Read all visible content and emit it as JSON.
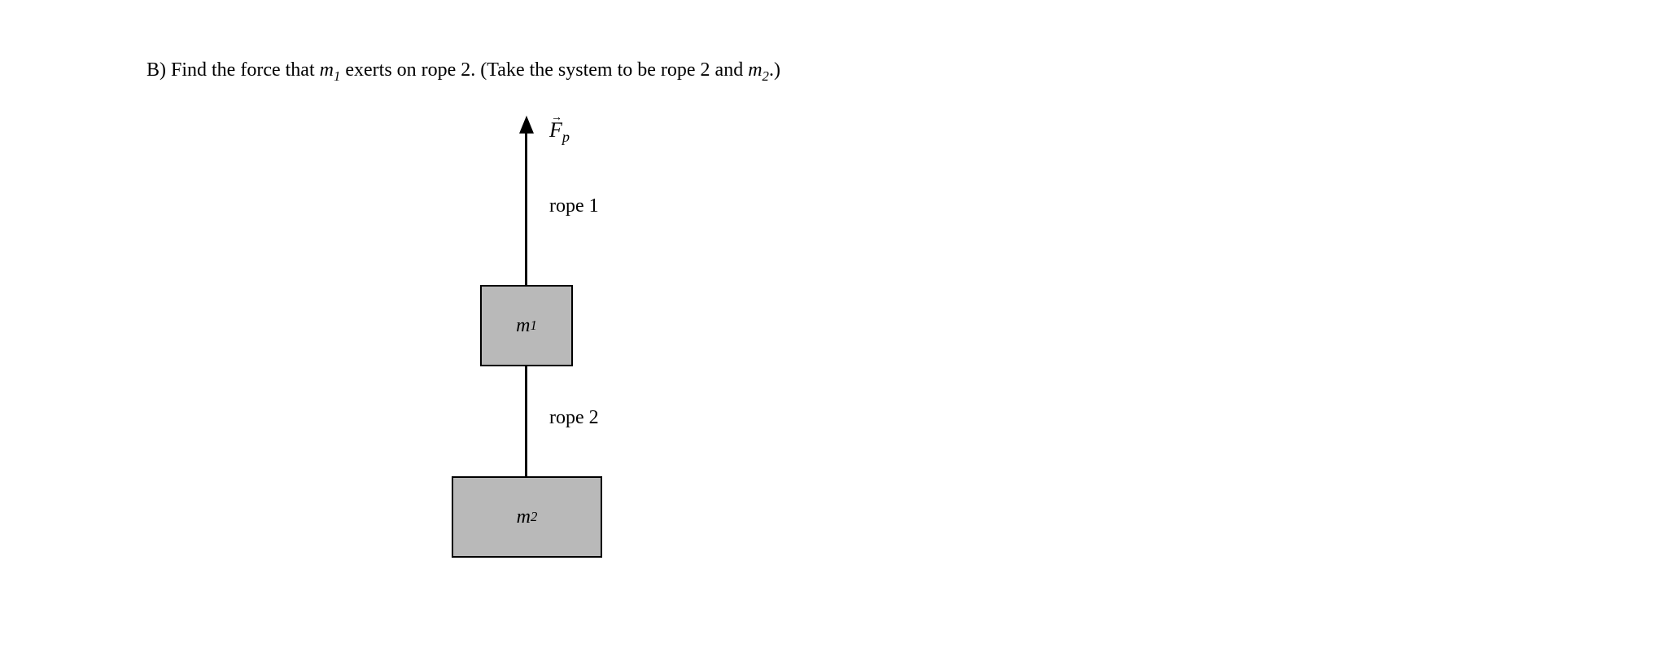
{
  "question": {
    "label": "B)",
    "prefix": "Find the force that ",
    "m1": "m",
    "m1_sub": "1",
    "middle": " exerts on rope 2. (Take the system to be rope 2 and ",
    "m2": "m",
    "m2_sub": "2",
    "suffix": ".)"
  },
  "diagram": {
    "force_label_F": "F",
    "force_label_sub": "p",
    "rope1_label": "rope 1",
    "rope2_label": "rope 2",
    "box_m1": "m",
    "box_m1_sub": "1",
    "box_m2": "m",
    "box_m2_sub": "2"
  }
}
